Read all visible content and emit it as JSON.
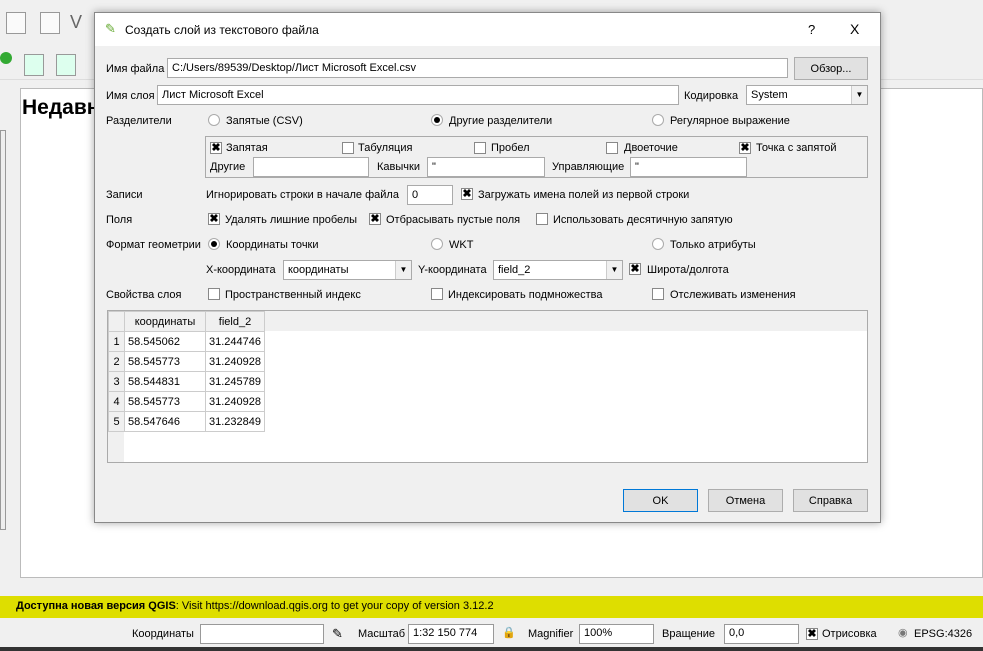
{
  "background": {
    "recent_heading": "Недавн"
  },
  "update_bar": {
    "bold": "Доступна новая версия QGIS",
    "text": ": Visit https://download.qgis.org to get your copy of version 3.12.2"
  },
  "statusbar": {
    "coords_label": "Координаты",
    "coords_value": "",
    "scale_label": "Масштаб",
    "scale_value": "1:32 150 774",
    "magnifier_label": "Magnifier",
    "magnifier_value": "100%",
    "rotation_label": "Вращение",
    "rotation_value": "0,0",
    "render_label": "Отрисовка",
    "render_checked": true,
    "crs": "EPSG:4326"
  },
  "dialog": {
    "title": "Создать слой из текстового файла",
    "help": "?",
    "close": "X",
    "file_label": "Имя файла",
    "file_value": "C:/Users/89539/Desktop/Лист Microsoft Excel.csv",
    "browse": "Обзор...",
    "layer_label": "Имя слоя",
    "layer_value": "Лист Microsoft Excel",
    "encoding_label": "Кодировка",
    "encoding_value": "System",
    "delims_label": "Разделители",
    "delim_csv": "Запятые (CSV)",
    "delim_custom": "Другие разделители",
    "delim_regex": "Регулярное выражение",
    "d_comma": "Запятая",
    "d_tab": "Табуляция",
    "d_space": "Пробел",
    "d_colon": "Двоеточие",
    "d_semicolon": "Точка с запятой",
    "other_label": "Другие",
    "other_value": "",
    "quote_label": "Кавычки",
    "quote_value": "\"",
    "escape_label": "Управляющие",
    "escape_value": "\"",
    "records_label": "Записи",
    "skip_label": "Игнорировать строки в начале файла",
    "skip_value": "0",
    "header_label": "Загружать имена полей из первой строки",
    "fields_label": "Поля",
    "trim_label": "Удалять лишние пробелы",
    "discard_label": "Отбрасывать пустые поля",
    "decimal_label": "Использовать десятичную запятую",
    "geom_label": "Формат геометрии",
    "geom_point": "Координаты точки",
    "geom_wkt": "WKT",
    "geom_none": "Только атрибуты",
    "x_label": "X-координата",
    "x_value": "координаты",
    "y_label": "Y-координата",
    "y_value": "field_2",
    "dms_label": "Широта/долгота",
    "props_label": "Свойства слоя",
    "spatial_index": "Пространственный индекс",
    "subset_index": "Индексировать подмножества",
    "watch": "Отслеживать изменения",
    "table": {
      "headers": [
        "координаты",
        "field_2"
      ],
      "rows": [
        [
          "1",
          "58.545062",
          "31.244746"
        ],
        [
          "2",
          "58.545773",
          "31.240928"
        ],
        [
          "3",
          "58.544831",
          "31.245789"
        ],
        [
          "4",
          "58.545773",
          "31.240928"
        ],
        [
          "5",
          "58.547646",
          "31.232849"
        ]
      ]
    },
    "ok": "OK",
    "cancel": "Отмена",
    "help_btn": "Справка"
  }
}
